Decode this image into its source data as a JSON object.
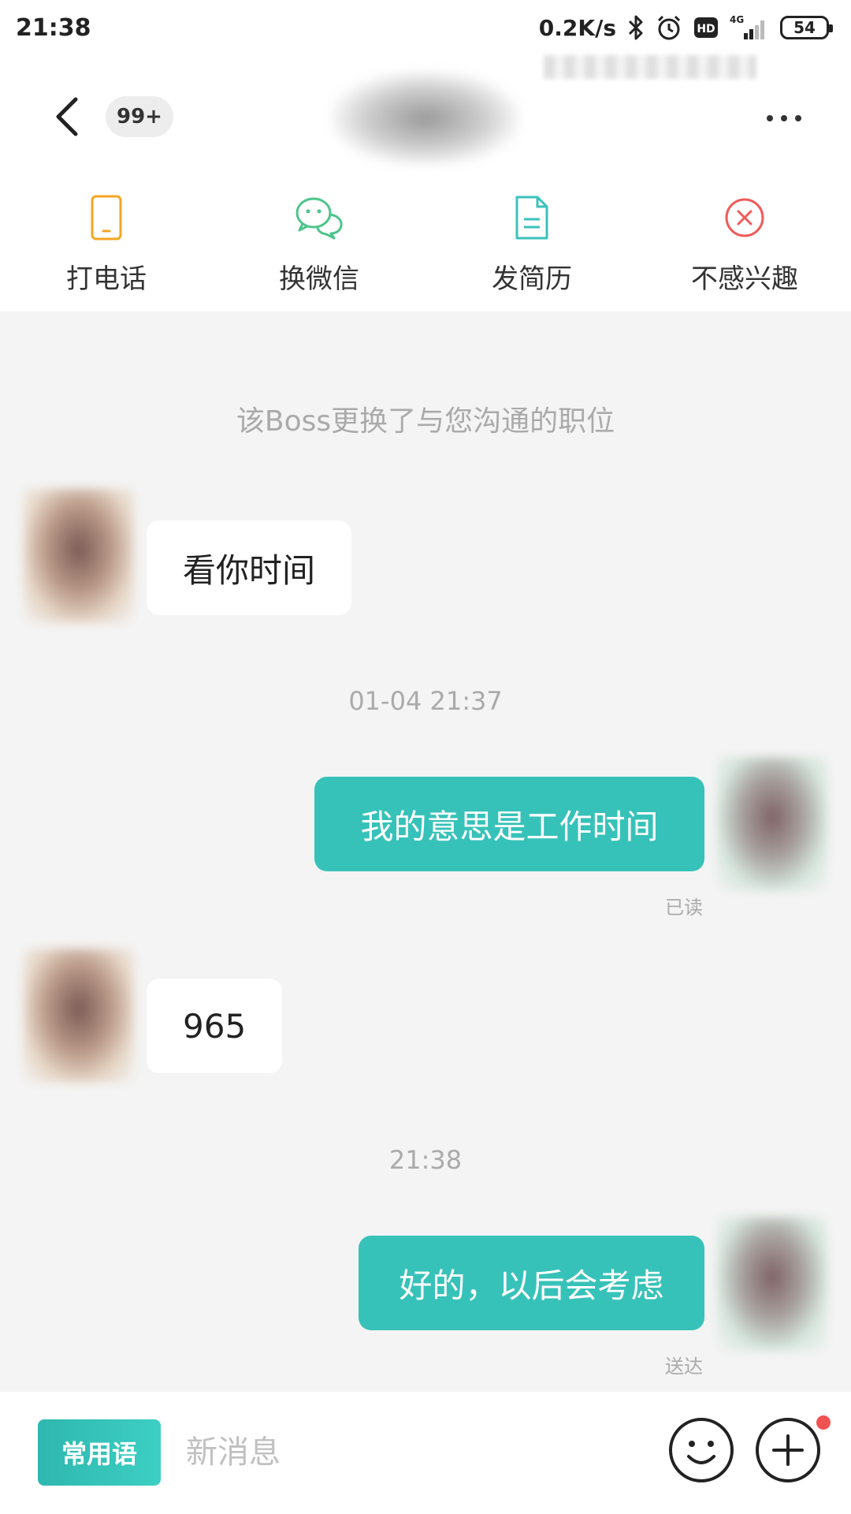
{
  "status_bar": {
    "time": "21:38",
    "net_speed": "0.2K/s",
    "hd_label": "HD",
    "network_type": "4G",
    "battery": "54",
    "icons": [
      "bluetooth-icon",
      "alarm-icon",
      "hd-icon",
      "signal-icon",
      "battery-icon"
    ]
  },
  "header": {
    "unread_count": "99+",
    "back_icon": "chevron-left-icon",
    "more_icon": "more-horizontal-icon"
  },
  "actions": [
    {
      "label": "打电话",
      "icon": "phone-icon",
      "color": "#f5a623"
    },
    {
      "label": "换微信",
      "icon": "wechat-icon",
      "color": "#4cc58a"
    },
    {
      "label": "发简历",
      "icon": "resume-icon",
      "color": "#3cc1bb"
    },
    {
      "label": "不感兴趣",
      "icon": "close-circle-icon",
      "color": "#ef5b5b"
    }
  ],
  "chat": {
    "system_notice": "该Boss更换了与您沟通的职位",
    "messages": [
      {
        "from": "other",
        "text": "看你时间"
      },
      {
        "type": "timestamp",
        "text": "01-04 21:37"
      },
      {
        "from": "me",
        "text": "我的意思是工作时间",
        "receipt": "已读"
      },
      {
        "from": "other",
        "text": "965"
      },
      {
        "type": "timestamp",
        "text": "21:38"
      },
      {
        "from": "me",
        "text": "好的，以后会考虑",
        "receipt": "送达"
      }
    ]
  },
  "input_bar": {
    "phrases_label": "常用语",
    "placeholder": "新消息",
    "emoji_icon": "smiley-icon",
    "plus_icon": "plus-circle-icon"
  },
  "colors": {
    "accent": "#37c2b9",
    "background": "#f4f4f4",
    "badge_dot": "#f25252"
  }
}
